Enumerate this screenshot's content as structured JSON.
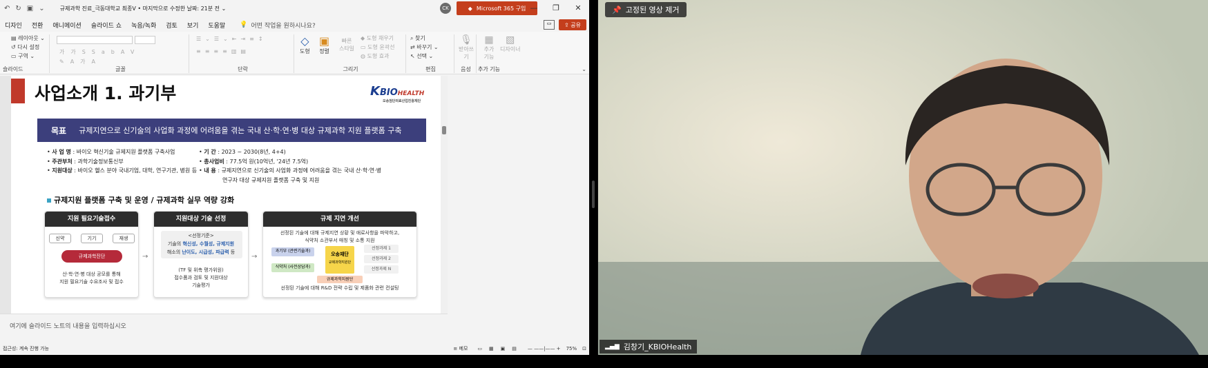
{
  "titlebar": {
    "doc_title": "규제과학 진료_극동대학교 최종V • 마지막으로 수정한 날짜: 21분 전 ⌄",
    "avatar_initials": "CK",
    "m365_label": "Microsoft 365 구입"
  },
  "menu": {
    "tabs": [
      "디자인",
      "전환",
      "애니메이션",
      "슬라이드 쇼",
      "녹음/녹화",
      "검토",
      "보기",
      "도움말"
    ],
    "tell_me": "어떤 작업을 원하시나요?",
    "share": "공유"
  },
  "ribbon": {
    "slides": {
      "layout": "레이아웃",
      "reset": "다시 설정",
      "section": "구역",
      "label": "슬라이드"
    },
    "font": {
      "label": "글꼴"
    },
    "paragraph": {
      "label": "단락"
    },
    "drawing": {
      "shape": "도형",
      "arrange": "정렬",
      "quick_style": "빠른 스타일",
      "fill": "도형 채우기",
      "outline": "도형 윤곽선",
      "effect": "도형 효과",
      "label": "그리기"
    },
    "editing": {
      "find": "찾기",
      "replace": "바꾸기",
      "select": "선택",
      "label": "편집"
    },
    "voice": {
      "dictate": "받아쓰기",
      "label": "음성"
    },
    "addins": {
      "addin": "추가 기능",
      "designer": "디자이너",
      "label": "추가 기능"
    }
  },
  "slide": {
    "title": "사업소개 1. 과기부",
    "logo_k": "K",
    "logo_bio": "BIO",
    "logo_health": "HEALTH",
    "logo_sub": "오송첨단의료산업진흥재단",
    "goal_label": "목표",
    "goal_text": "규제지연으로 신기술의 사업화 과정에 어려움을 겪는 국내 산·학·연·병 대상 규제과학 지원 플랫폼 구축",
    "left_bullets": [
      {
        "key": "사 업 명",
        "val": " : 바이오 혁신기술 규제지원 플랫폼 구축사업"
      },
      {
        "key": "주관부처",
        "val": " : 과학기술정보통신부"
      },
      {
        "key": "지원대상",
        "val": " : 바이오 헬스 분야 국내기업, 대학, 연구기관, 병원 등"
      }
    ],
    "right_bullets": [
      {
        "key": "기 간",
        "val": " : 2023 ~ 2030(8년, 4+4)"
      },
      {
        "key": "총사업비",
        "val": " : 77.5억 원(10억년, '24년 7.5억)"
      },
      {
        "key": "내 용",
        "val": " : 규제지연으로 신기술의 사업화 과정에 어려움을 겪는 국내 산·학·연·병"
      }
    ],
    "right_bullet_cont": "연구자 대상 규제지원 플랫폼 구축 및 지원",
    "section_title": "규제지원 플랫폼 구축 및 운영 / 규제과학 실무 역량 강화",
    "card1": {
      "header": "지원 필요기술접수",
      "chips": [
        "신약",
        "기기",
        "재생"
      ],
      "pill": "규제과학진단",
      "text1": "산·학·연·병 대상 공모를 통해",
      "text2": "지원 필요기술 수요조사 및 접수"
    },
    "card2": {
      "header": "지원대상 기술 선정",
      "criteria_title": "<선정기준>",
      "line1_a": "기술의 ",
      "line1_b": "혁신성, 수월성, 규제지원",
      "line2_a": "해소의 ",
      "line2_b": "난이도, 시급성, 파급력",
      "line2_c": " 등",
      "text1": "(TF 및 위촉 평가위원)",
      "text2": "접수품과 검토 및 지원대상",
      "text3": "기술평가"
    },
    "card3": {
      "header": "규제 지연 개선",
      "text1": "선정된 기술에 대해 규제지연 상황 및 애로사항을 파악하고,",
      "text2": "식약처 소관부서 매칭 및 소통 지원",
      "left_box1": "과기부 (관련기술과)",
      "left_box2": "식약처 (사전상담과)",
      "center_box": "오송재단",
      "center_sub": "규제과학지원단",
      "tasks": [
        "선정과제 1",
        "선정과제 2",
        "선정과제 N"
      ],
      "bottom_tag": "규제과학지원단",
      "footer": "선정된 기술에 대해 R&D 전략 수립 및 제품화 관련 컨설팅"
    }
  },
  "notes_placeholder": "여기에 슬라이드 노트의 내용을 입력하십시오",
  "status": {
    "accessibility": "접근성: 계속 진행 가능",
    "notes": "메모",
    "zoom": "75%"
  },
  "video": {
    "pin_label": "고정된 영상 제거",
    "participant_name": "김창기_KBIOHealth"
  },
  "colors": {
    "accent_red": "#c43e1c",
    "slide_navy": "#3c3f7c",
    "pill_red": "#b52a3a"
  }
}
